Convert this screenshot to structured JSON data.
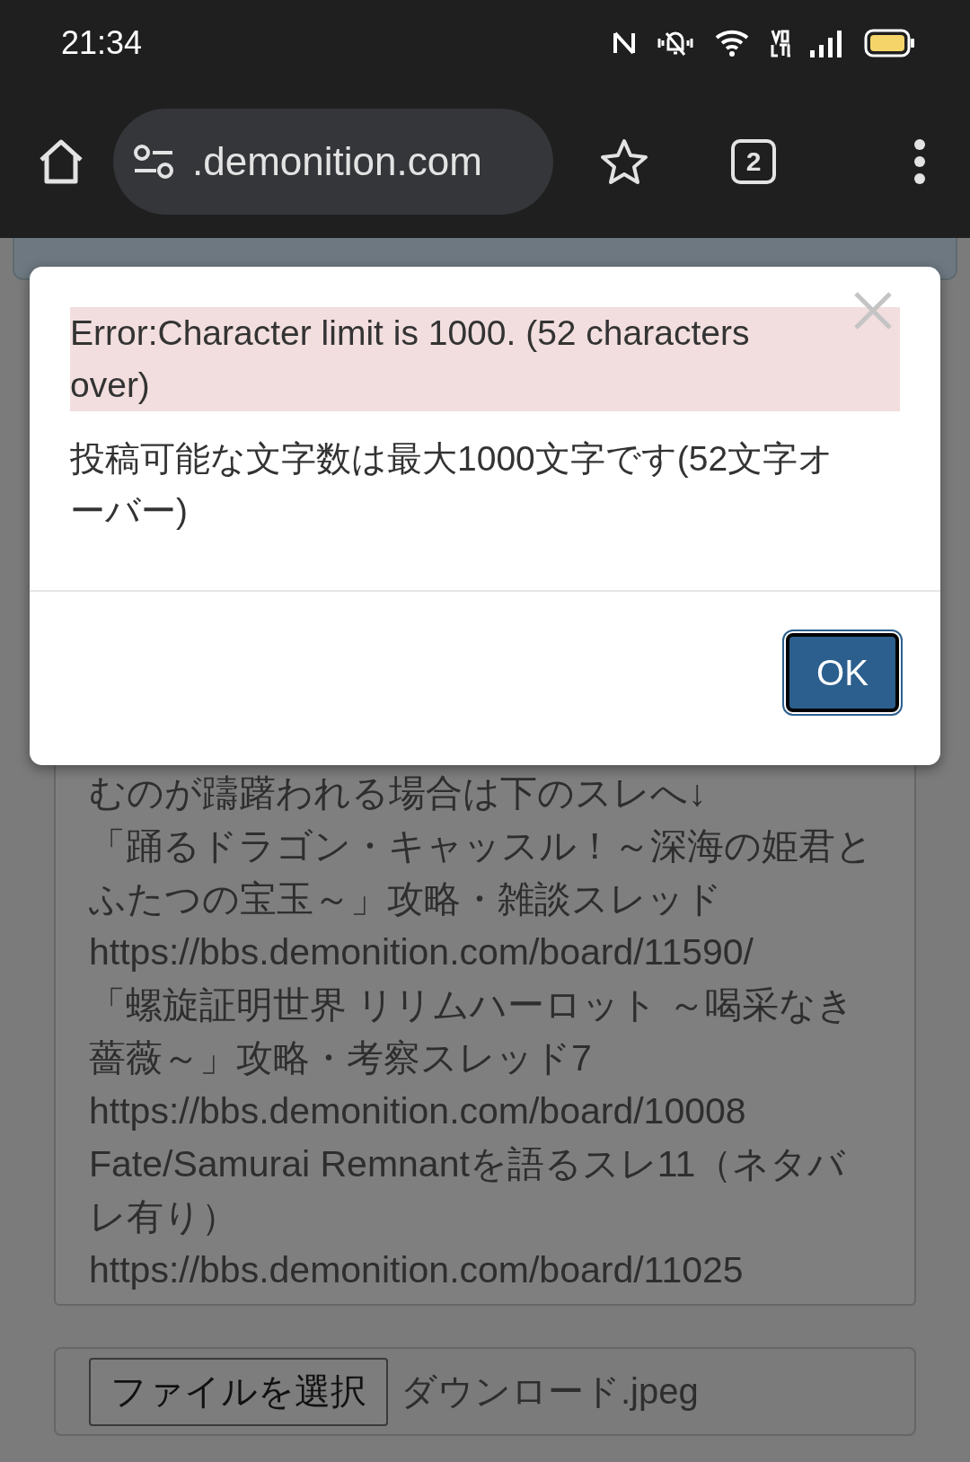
{
  "status_bar": {
    "time": "21:34"
  },
  "toolbar": {
    "url": ".demonition.com",
    "tab_count": "2"
  },
  "dialog": {
    "error_message": "Error:Character limit is 1000. (52 characters over)",
    "message": "投稿可能な文字数は最大1000文字です(52文字オーバー)",
    "ok_button": "OK"
  },
  "form": {
    "textarea_lines": [
      "むのが躊躇われる場合は下のスレへ↓",
      "「踊るドラゴン・キャッスル！～深海の姫君と",
      "ふたつの宝玉～」攻略・雑談スレッド",
      "https://bbs.demonition.com/board/11590/",
      "「螺旋証明世界 リリムハーロット ～喝采なき",
      "薔薇～」攻略・考察スレッド7",
      "https://bbs.demonition.com/board/10008",
      "Fate/Samurai Remnantを語るスレ11（ネタバ",
      "レ有り）",
      "https://bbs.demonition.com/board/11025"
    ],
    "file_button": "ファイルを選択",
    "file_name": "ダウンロード.jpeg"
  }
}
